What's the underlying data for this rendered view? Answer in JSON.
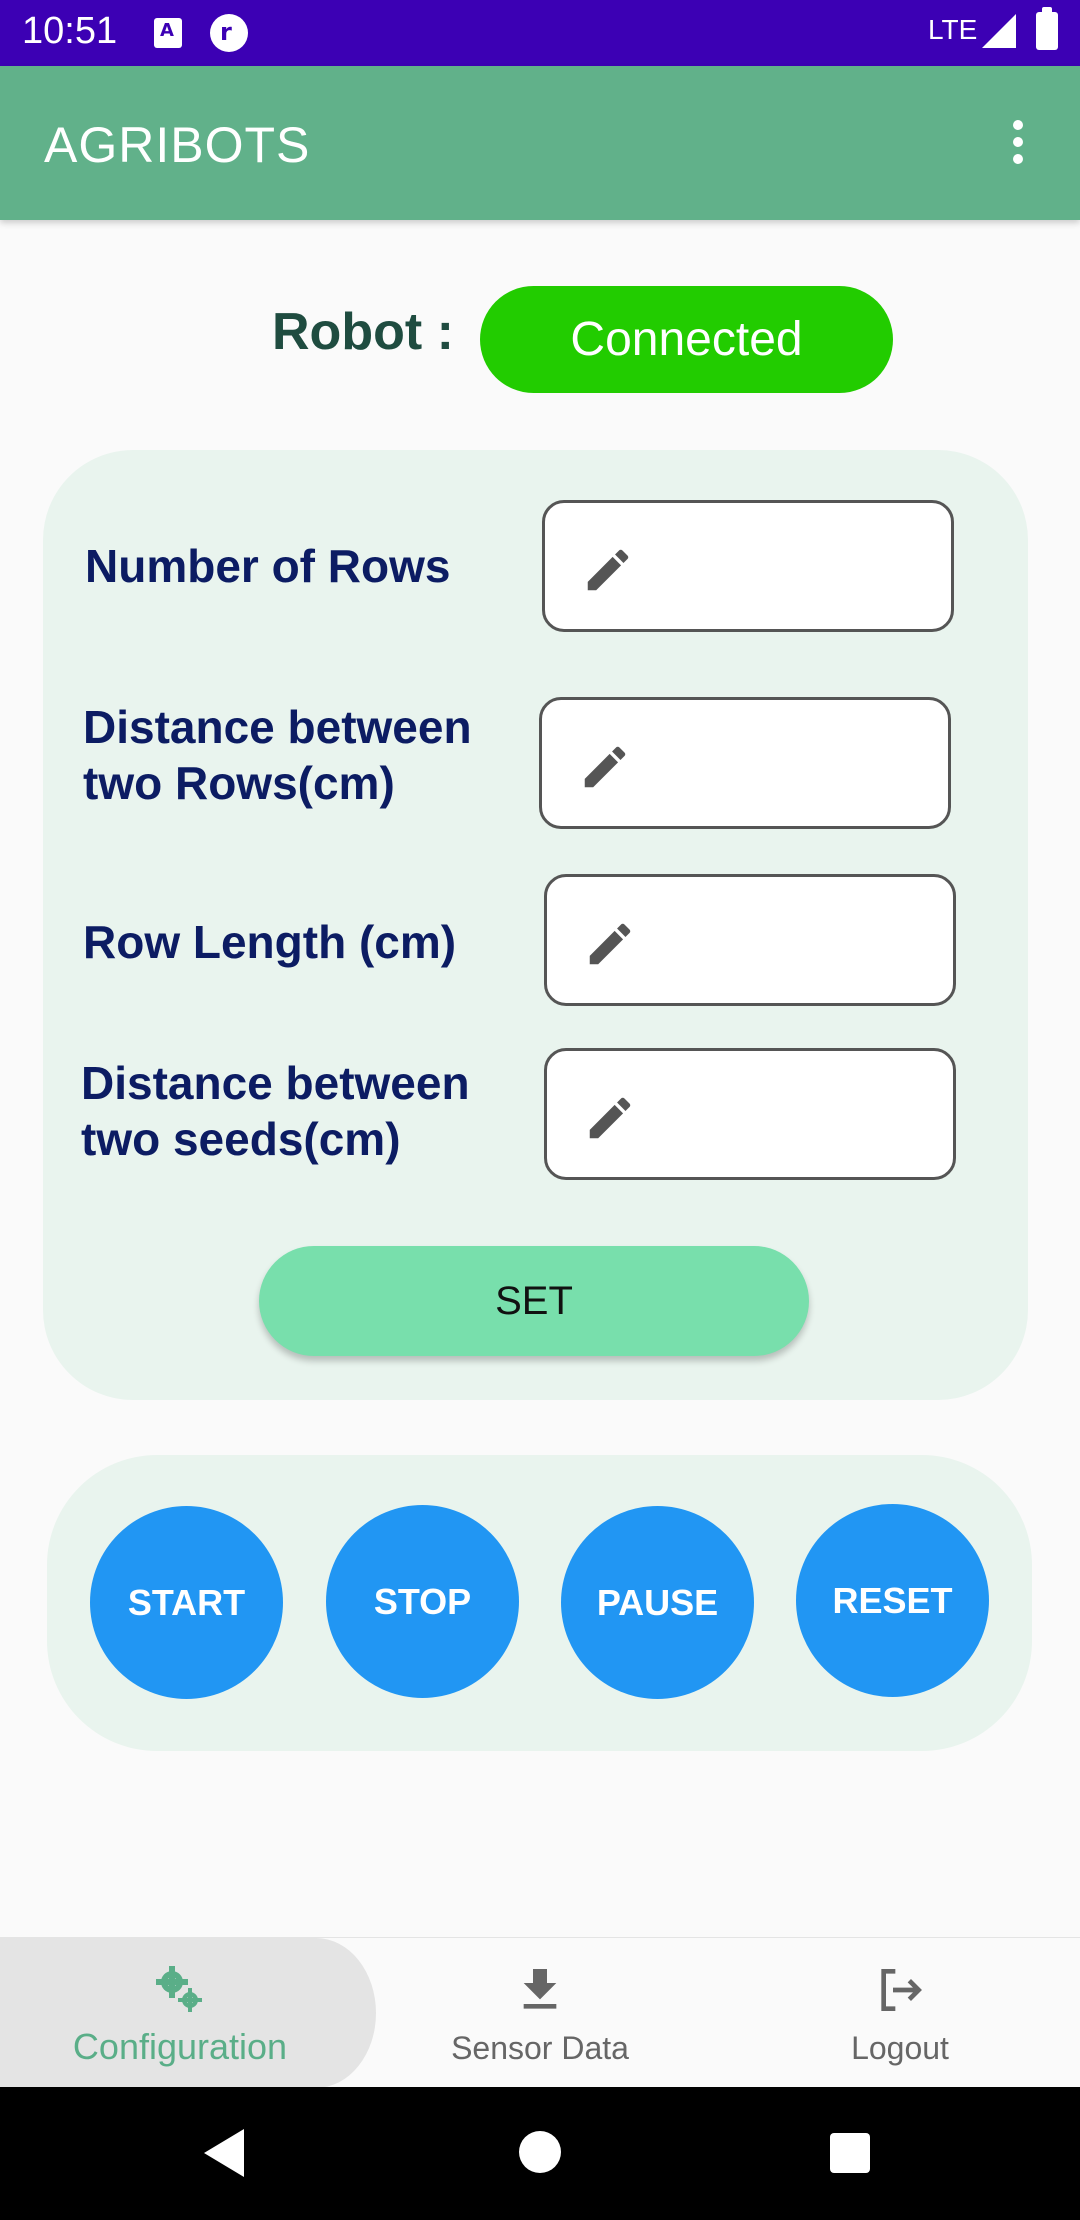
{
  "status_bar": {
    "time": "10:51",
    "notification_icons": [
      "a-icon",
      "r-icon"
    ],
    "network": "LTE",
    "icons": [
      "signal-icon",
      "battery-icon"
    ]
  },
  "app_bar": {
    "title": "AGRIBOTS",
    "menu_icon": "more-vert-icon",
    "background_color": "#61b18a"
  },
  "robot_status": {
    "label": "Robot :",
    "status": "Connected",
    "status_color": "#22cc00"
  },
  "config_form": {
    "fields": [
      {
        "label": "Number of Rows",
        "value": "",
        "icon": "pencil-icon"
      },
      {
        "label": "Distance between two Rows(cm)",
        "value": "",
        "icon": "pencil-icon"
      },
      {
        "label": "Row Length (cm)",
        "value": "",
        "icon": "pencil-icon"
      },
      {
        "label": "Distance between two seeds(cm)",
        "value": "",
        "icon": "pencil-icon"
      }
    ],
    "set_label": "SET",
    "set_color": "#78dfac"
  },
  "controls": {
    "buttons": [
      {
        "label": "START"
      },
      {
        "label": "STOP"
      },
      {
        "label": "PAUSE"
      },
      {
        "label": "RESET"
      }
    ],
    "button_color": "#2196f3"
  },
  "bottom_nav": {
    "items": [
      {
        "label": "Configuration",
        "icon": "gears-icon",
        "active": true
      },
      {
        "label": "Sensor Data",
        "icon": "download-icon",
        "active": false
      },
      {
        "label": "Logout",
        "icon": "logout-icon",
        "active": false
      }
    ],
    "active_color": "#5aae88"
  },
  "system_nav": {
    "icons": [
      "back-icon",
      "home-icon",
      "recents-icon"
    ]
  }
}
